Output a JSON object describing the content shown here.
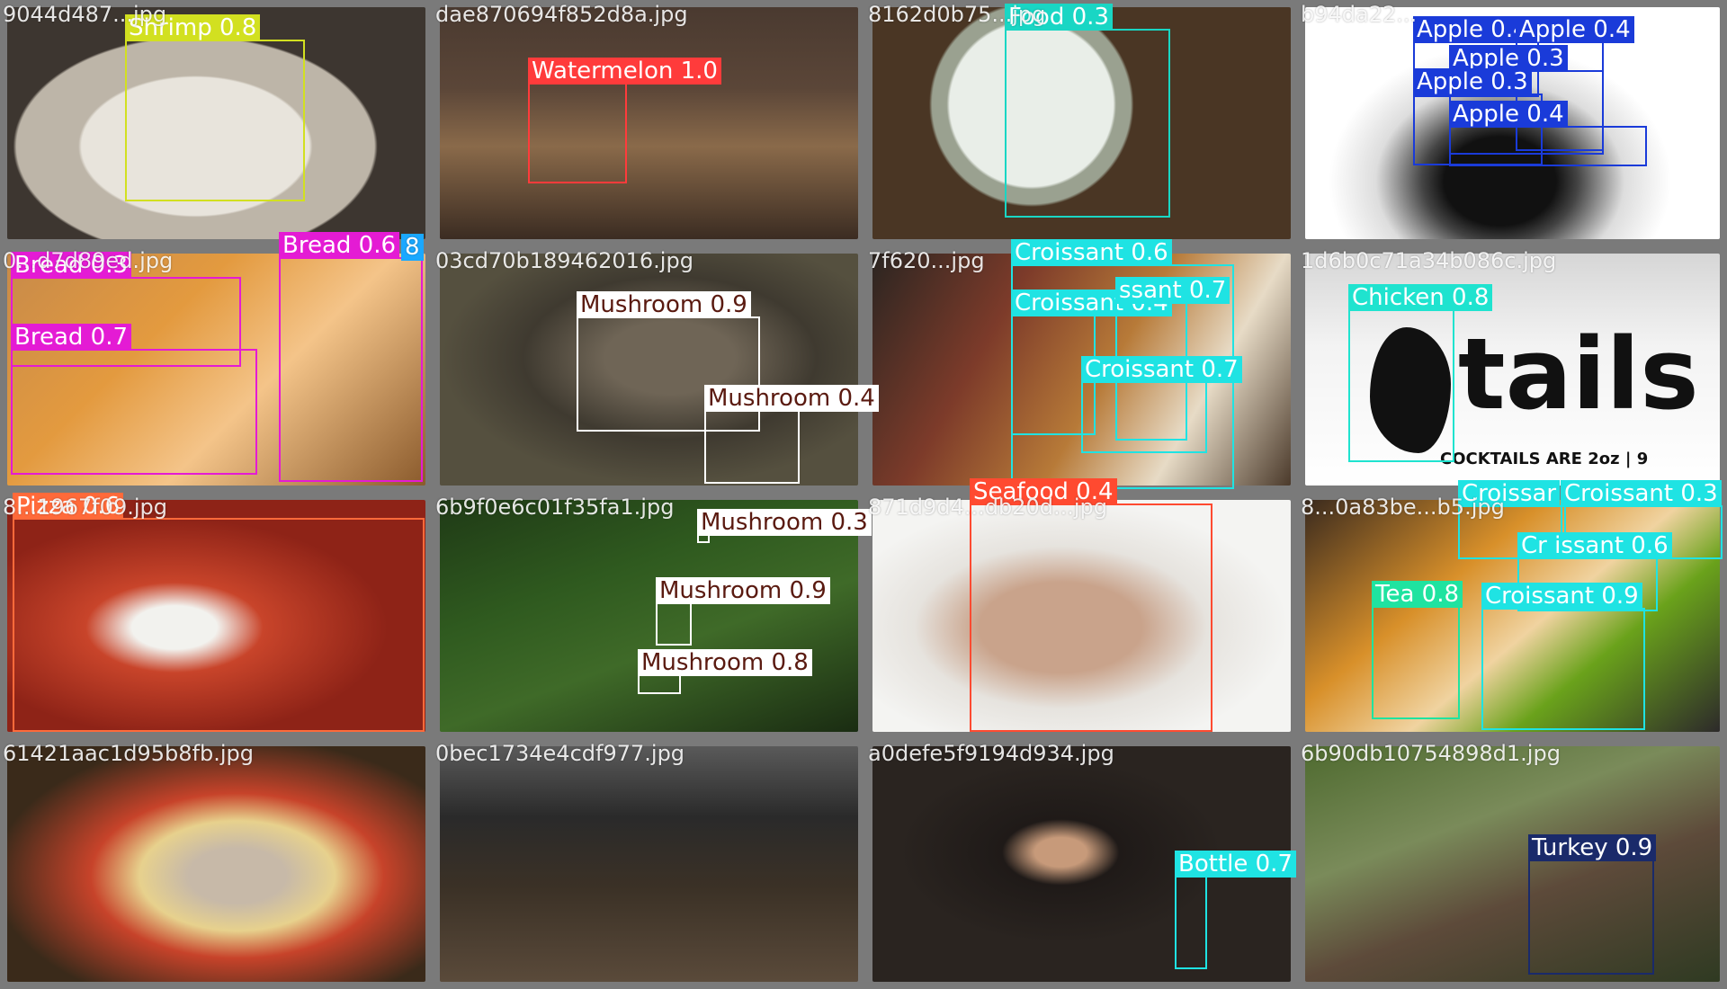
{
  "tiles": [
    {
      "filename": "9044d487...jpg",
      "detections": [
        {
          "label": "Shrimp 0.8",
          "color": "#d2e020",
          "text_color": "#ffffff"
        }
      ]
    },
    {
      "filename": "dae870694f852d8a.jpg",
      "detections": [
        {
          "label": "Watermelon 1.0",
          "color": "#ff3b3b",
          "text_color": "#ffffff"
        }
      ]
    },
    {
      "filename": "8162d0b75...jpg",
      "detections": [
        {
          "label": "Food 0.3",
          "color": "#19d6c4",
          "text_color": "#ffffff"
        }
      ]
    },
    {
      "filename": "b94da22...",
      "detections": [
        {
          "label": "Apple 0.4",
          "color": "#1a3bd9",
          "text_color": "#ffffff"
        },
        {
          "label": "Apple 0.4",
          "color": "#1a3bd9",
          "text_color": "#ffffff"
        },
        {
          "label": "Apple 0.3",
          "color": "#1a3bd9",
          "text_color": "#ffffff"
        },
        {
          "label": "Apple 0.3",
          "color": "#1a3bd9",
          "text_color": "#ffffff"
        },
        {
          "label": "Apple 0.4",
          "color": "#1a3bd9",
          "text_color": "#ffffff"
        }
      ]
    },
    {
      "filename": "0...d7d89ed.jpg",
      "detections": [
        {
          "label": "Bread 0.3",
          "color": "#e41bd4",
          "text_color": "#ffffff"
        },
        {
          "label": "Bread 0.7",
          "color": "#e41bd4",
          "text_color": "#ffffff"
        },
        {
          "label": "Bread 0.6",
          "color": "#e41bd4",
          "text_color": "#ffffff"
        },
        {
          "label": "8",
          "color": "#1aa8ff",
          "text_color": "#ffffff"
        }
      ]
    },
    {
      "filename": "03cd70b189462016.jpg",
      "detections": [
        {
          "label": "Mushroom 0.9",
          "color": "#ffffff",
          "text_color": "#5a1a10"
        },
        {
          "label": "Mushroom 0.4",
          "color": "#ffffff",
          "text_color": "#5a1a10"
        }
      ]
    },
    {
      "filename": "7f620...jpg",
      "detections": [
        {
          "label": "Croissant 0.6",
          "color": "#1fe3e3",
          "text_color": "#ffffff"
        },
        {
          "label": "Croissant 0.4",
          "color": "#1fe3e3",
          "text_color": "#ffffff"
        },
        {
          "label": "ssant 0.7",
          "color": "#1fe3e3",
          "text_color": "#ffffff"
        },
        {
          "label": "Croissant 0.7",
          "color": "#1fe3e3",
          "text_color": "#ffffff"
        }
      ]
    },
    {
      "filename": "1d6b0c71a34b086c.jpg",
      "detections": [
        {
          "label": "Chicken 0.8",
          "color": "#1fe3cf",
          "text_color": "#ffffff"
        }
      ]
    },
    {
      "filename": "8...1967f09.jpg",
      "detections": [
        {
          "label": "Pizza 0.6",
          "color": "#ff6a3a",
          "text_color": "#ffffff"
        }
      ]
    },
    {
      "filename": "6b9f0e6c01f35fa1.jpg",
      "detections": [
        {
          "label": "Mushroom 0.3",
          "color": "#ffffff",
          "text_color": "#5a1a10"
        },
        {
          "label": "Mushroom 0.9",
          "color": "#ffffff",
          "text_color": "#5a1a10"
        },
        {
          "label": "Mushroom 0.8",
          "color": "#ffffff",
          "text_color": "#5a1a10"
        }
      ]
    },
    {
      "filename": "871d9d4...db20d...jpg",
      "detections": [
        {
          "label": "Seafood 0.4",
          "color": "#ff4a30",
          "text_color": "#ffffff"
        }
      ]
    },
    {
      "filename": "8...0a83be...b5.jpg",
      "detections": [
        {
          "label": "Croissar",
          "color": "#1fe3e3",
          "text_color": "#ffffff"
        },
        {
          "label": "Croissant 0.3",
          "color": "#1fe3e3",
          "text_color": "#ffffff"
        },
        {
          "label": "Cr issant 0.6",
          "color": "#1fe3e3",
          "text_color": "#ffffff"
        },
        {
          "label": "Tea 0.8",
          "color": "#1fe3a0",
          "text_color": "#ffffff"
        },
        {
          "label": "Croissant 0.9",
          "color": "#1fe3e3",
          "text_color": "#ffffff"
        }
      ]
    },
    {
      "filename": "61421aac1d95b8fb.jpg",
      "detections": []
    },
    {
      "filename": "0bec1734e4cdf977.jpg",
      "detections": []
    },
    {
      "filename": "a0defe5f9194d934.jpg",
      "detections": [
        {
          "label": "Bottle 0.7",
          "color": "#1fe3e3",
          "text_color": "#ffffff"
        }
      ]
    },
    {
      "filename": "6b90db10754898d1.jpg",
      "detections": [
        {
          "label": "Turkey 0.9",
          "color": "#1a2a6a",
          "text_color": "#ffffff"
        }
      ]
    }
  ]
}
